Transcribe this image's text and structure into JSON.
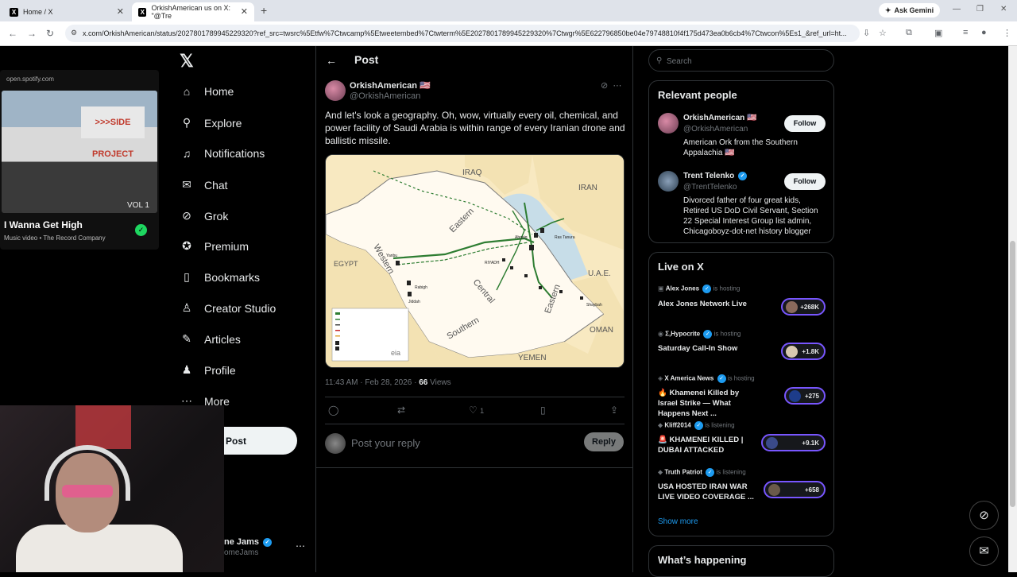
{
  "browser": {
    "tabs": [
      {
        "label": "Home / X",
        "active": false
      },
      {
        "label": "OrkishAmerican us on X: \"@Tre",
        "active": true
      }
    ],
    "ask_gemini": "Ask Gemini",
    "url": "x.com/OrkishAmerican/status/2027801789945229320?ref_src=twsrc%5Etfw%7Ctwcamp%5Etweetembed%7Ctwterm%5E2027801789945229320%7Ctwgr%5E622796850be04e79748810f4f175d473ea0b6cb4%7Ctwcon%5Es1_&ref_url=ht..."
  },
  "spotify": {
    "source": "open.spotify.com",
    "sign_text": ">>>SIDE PROJECT",
    "vol_text": "VOL 1",
    "title": "I Wanna Get High",
    "subtitle": "Music video • The Record Company"
  },
  "nav": {
    "items": [
      {
        "label": "Home",
        "icon": "home-icon"
      },
      {
        "label": "Explore",
        "icon": "search-icon"
      },
      {
        "label": "Notifications",
        "icon": "bell-icon"
      },
      {
        "label": "Chat",
        "icon": "mail-icon"
      },
      {
        "label": "Grok",
        "icon": "grok-icon"
      },
      {
        "label": "Premium",
        "icon": "premium-icon"
      },
      {
        "label": "Bookmarks",
        "icon": "bookmark-icon"
      },
      {
        "label": "Creator Studio",
        "icon": "creator-icon"
      },
      {
        "label": "Articles",
        "icon": "articles-icon"
      },
      {
        "label": "Profile",
        "icon": "profile-icon"
      },
      {
        "label": "More",
        "icon": "more-icon"
      }
    ],
    "post_button": "Post",
    "account_name": "ne Jams",
    "account_handle": "omeJams"
  },
  "post": {
    "header": "Post",
    "author_name": "OrkishAmerican 🇺🇸",
    "author_handle": "@OrkishAmerican",
    "text": "And let's look a geography. Oh, wow, virtually every oil, chemical, and power facility of Saudi Arabia is within range of every Iranian drone and ballistic missile.",
    "timestamp": "11:43 AM · Feb 28, 2026 · ",
    "views_count": "66",
    "views_label": " Views",
    "likes": "1",
    "reply_placeholder": "Post your reply",
    "reply_button": "Reply",
    "map_labels": {
      "iraq": "IRAQ",
      "iran": "IRAN",
      "egypt": "EGYPT",
      "uae": "U.A.E.",
      "oman": "OMAN",
      "yemen": "YEMEN",
      "western": "Western",
      "eastern": "Eastern",
      "central": "Central",
      "southern": "Southern",
      "eastern2": "Eastern",
      "riyadh": "RIYADH",
      "yanbu": "Yanbu",
      "rabigh": "Rabigh",
      "jiddah": "Jiddah",
      "ras_tanura": "Ras Tanura",
      "abqaiq": "Abqaiq",
      "shaybah": "Shaybah",
      "eia": "eia"
    }
  },
  "right": {
    "search_placeholder": "Search",
    "relevant_title": "Relevant people",
    "people": [
      {
        "name": "OrkishAmerican 🇺🇸",
        "handle": "@OrkishAmerican",
        "bio": "American Ork from the Southern Appalachia 🇺🇸",
        "follow": "Follow"
      },
      {
        "name": "Trent Telenko",
        "handle": "@TrentTelenko",
        "bio": "Divorced father of four great kids, Retired US DoD Civil Servant, Section 22 Special Interest Group list admin, Chicagoboyz-dot-net history blogger",
        "follow": "Follow"
      }
    ],
    "live_title": "Live on X",
    "live": [
      {
        "host": "Alex Jones",
        "status": " is hosting",
        "title": "Alex Jones Network Live",
        "count": "+268K"
      },
      {
        "host": "Σ,Hypocrite",
        "status": " is hosting",
        "title": "Saturday Call-In Show",
        "count": "+1.8K"
      },
      {
        "host": "X America News",
        "status": " is hosting",
        "title": "🔥 Khamenei Killed by Israel Strike — What Happens Next ...",
        "count": "+275"
      },
      {
        "host": "Kliff2014",
        "status": " is listening",
        "title": "🚨 KHAMENEI KILLED | DUBAI ATTACKED",
        "count": "+9.1K"
      },
      {
        "host": "Truth Patriot",
        "status": " is listening",
        "title": "USA HOSTED IRAN WAR LIVE VIDEO COVERAGE ...",
        "count": "+658"
      }
    ],
    "show_more": "Show more",
    "whats_happening": "What’s happening"
  },
  "colors": {
    "accent": "#1d9bf0",
    "live_border": "#7856ff",
    "spotify_green": "#1ed760"
  }
}
